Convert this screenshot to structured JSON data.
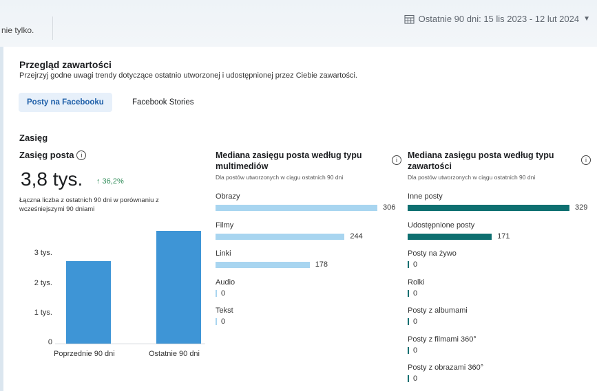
{
  "topbar": {
    "cut_text": "nie tylko.",
    "date_range": "Ostatnie 90 dni: 15 lis 2023 - 12 lut 2024"
  },
  "overview": {
    "title": "Przegląd zawartości",
    "subtitle": "Przejrzyj godne uwagi trendy dotyczące ostatnio utworzonej i udostępnionej przez Ciebie zawartości."
  },
  "tabs": [
    {
      "label": "Posty na Facebooku",
      "active": true
    },
    {
      "label": "Facebook Stories",
      "active": false
    }
  ],
  "section": {
    "title": "Zasięg"
  },
  "reach": {
    "title": "Zasięg posta",
    "value": "3,8 tys.",
    "delta": "↑ 36,2%",
    "description": "Łączna liczba z ostatnich 90 dni w porównaniu z wcześniejszymi 90 dniami"
  },
  "chart_data": [
    {
      "type": "bar",
      "categories": [
        "Poprzednie 90 dni",
        "Ostatnie 90 dni"
      ],
      "values": [
        2780,
        3790
      ],
      "ylim": [
        0,
        4000
      ],
      "ytick_labels": [
        "0",
        "1 tys.",
        "2 tys.",
        "3 tys."
      ],
      "color": "#3e95d6"
    },
    {
      "type": "bar",
      "orientation": "horizontal",
      "title": "Mediana zasięgu posta według typu multimediów",
      "subtitle": "Dla postów utworzonych w ciągu ostatnich 90 dni",
      "categories": [
        "Obrazy",
        "Filmy",
        "Linki",
        "Audio",
        "Tekst"
      ],
      "values": [
        306,
        244,
        178,
        0,
        0
      ],
      "color": "#a8d5f0"
    },
    {
      "type": "bar",
      "orientation": "horizontal",
      "title": "Mediana zasięgu posta według typu zawartości",
      "subtitle": "Dla postów utworzonych w ciągu ostatnich 90 dni",
      "categories": [
        "Inne posty",
        "Udostępnione posty",
        "Posty na żywo",
        "Rolki",
        "Posty z albumami",
        "Posty z filmami 360°",
        "Posty z obrazami 360°"
      ],
      "values": [
        329,
        171,
        0,
        0,
        0,
        0,
        0
      ],
      "color": "#0e6f70"
    }
  ]
}
